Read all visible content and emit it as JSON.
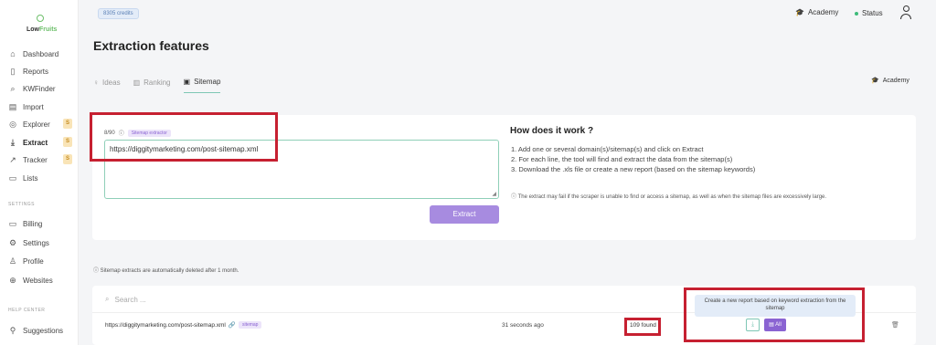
{
  "logo": {
    "prefix": "Low",
    "suffix": "Fruits"
  },
  "sidebar": {
    "items": [
      {
        "label": "Dashboard",
        "icon": "⌂"
      },
      {
        "label": "Reports",
        "icon": "▯"
      },
      {
        "label": "KWFinder",
        "icon": "⌕"
      },
      {
        "label": "Import",
        "icon": "▤"
      },
      {
        "label": "Explorer",
        "icon": "◎",
        "badge": "S"
      },
      {
        "label": "Extract",
        "icon": "⤓",
        "badge": "S"
      },
      {
        "label": "Tracker",
        "icon": "↗",
        "badge": "S"
      },
      {
        "label": "Lists",
        "icon": "▭"
      }
    ],
    "settings_label": "SETTINGS",
    "settings_items": [
      {
        "label": "Billing",
        "icon": "▭"
      },
      {
        "label": "Settings",
        "icon": "⚙"
      },
      {
        "label": "Profile",
        "icon": "♙"
      },
      {
        "label": "Websites",
        "icon": "⊕"
      }
    ],
    "help_label": "HELP CENTER",
    "help_items": [
      {
        "label": "Suggestions",
        "icon": "⚲"
      }
    ]
  },
  "topbar": {
    "credits": "8305 credits",
    "academy": "Academy",
    "status": "Status"
  },
  "page_title": "Extraction features",
  "tabs": [
    {
      "label": "Ideas",
      "icon": "♀"
    },
    {
      "label": "Ranking",
      "icon": "▥"
    },
    {
      "label": "Sitemap",
      "icon": "▣"
    }
  ],
  "academy_link": "Academy",
  "extractor": {
    "count": "8/90",
    "tag": "Sitemap extractor",
    "input_value": "https://diggitymarketing.com/post-sitemap.xml",
    "button": "Extract"
  },
  "how": {
    "title": "How does it work ?",
    "steps": [
      "1. Add one or several domain(s)/sitemap(s) and click on Extract",
      "2. For each line, the tool will find and extract the data from the sitemap(s)",
      "3. Download the .xls file or create a new report (based on the sitemap keywords)"
    ],
    "note": "The extract may fail if the scraper is unable to find or access a sitemap, as well as when the sitemap files are excessively large."
  },
  "auto_delete_note": "Sitemap extracts are automatically deleted after 1 month.",
  "table": {
    "search_placeholder": "Search ...",
    "tooltip": "Create a new report based on keyword extraction from the sitemap",
    "row": {
      "url": "https://diggitymarketing.com/post-sitemap.xml",
      "tag": "sitemap",
      "time": "31 seconds ago",
      "found": "109 found",
      "all_label": "All"
    }
  },
  "colors": {
    "accent": "#a78be0",
    "highlight": "#c62031",
    "teal": "#7ec7b5"
  }
}
